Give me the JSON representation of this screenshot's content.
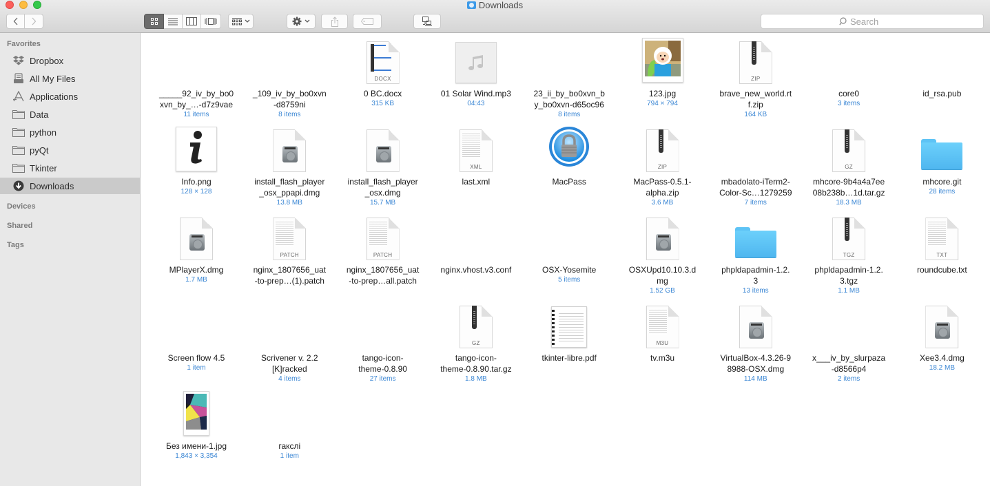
{
  "window": {
    "title": "Downloads",
    "search_placeholder": "Search"
  },
  "toolbar": {
    "back_icon": "chevron-left-icon",
    "forward_icon": "chevron-right-icon",
    "view_modes": [
      "icon-view",
      "list-view",
      "column-view",
      "cover-flow-view"
    ],
    "active_view": "icon-view",
    "arrange_icon": "arrange-grid-icon",
    "action_icon": "gear-icon",
    "share_icon": "share-icon",
    "tag_icon": "tag-icon",
    "network_icon": "connect-server-icon"
  },
  "sidebar": {
    "favorites_header": "Favorites",
    "devices_header": "Devices",
    "shared_header": "Shared",
    "tags_header": "Tags",
    "items": [
      {
        "label": "Dropbox",
        "icon": "dropbox-icon"
      },
      {
        "label": "All My Files",
        "icon": "all-files-icon"
      },
      {
        "label": "Applications",
        "icon": "applications-icon"
      },
      {
        "label": "Data",
        "icon": "folder-icon"
      },
      {
        "label": "python",
        "icon": "folder-icon"
      },
      {
        "label": "pyQt",
        "icon": "folder-icon"
      },
      {
        "label": "Tkinter",
        "icon": "folder-icon"
      },
      {
        "label": "Downloads",
        "icon": "downloads-icon",
        "selected": true
      }
    ]
  },
  "files": [
    {
      "name": "_____92_iv_by_bo0xvn_by_…-d7z9vae",
      "meta": "11 items",
      "type": "none"
    },
    {
      "name": "_109_iv_by_bo0xvn-d8759ni",
      "meta": "8 items",
      "type": "none"
    },
    {
      "name": "0 BC.docx",
      "meta": "315 KB",
      "type": "docx",
      "label": "DOCX"
    },
    {
      "name": "01 Solar Wind.mp3",
      "meta": "04:43",
      "type": "audio"
    },
    {
      "name": "23_ii_by_bo0xvn_by_bo0xvn-d65oc96",
      "meta": "8 items",
      "type": "none"
    },
    {
      "name": "123.jpg",
      "meta": "794 × 794",
      "type": "image-finn"
    },
    {
      "name": "brave_new_world.rtf.zip",
      "meta": "164 KB",
      "type": "zip",
      "label": "ZIP"
    },
    {
      "name": "core0",
      "meta": "3 items",
      "type": "none"
    },
    {
      "name": "id_rsa.pub",
      "meta": "",
      "type": "none"
    },
    {
      "name": "Info.png",
      "meta": "128 × 128",
      "type": "image-info"
    },
    {
      "name": "install_flash_player_osx_ppapi.dmg",
      "meta": "13.8 MB",
      "type": "dmg"
    },
    {
      "name": "install_flash_player_osx.dmg",
      "meta": "15.7 MB",
      "type": "dmg"
    },
    {
      "name": "last.xml",
      "meta": "",
      "type": "text",
      "label": "XML"
    },
    {
      "name": "MacPass",
      "meta": "",
      "type": "app-macpass"
    },
    {
      "name": "MacPass-0.5.1-alpha.zip",
      "meta": "3.6 MB",
      "type": "zip",
      "label": "ZIP"
    },
    {
      "name": "mbadolato-iTerm2-Color-Sc…1279259",
      "meta": "7 items",
      "type": "none"
    },
    {
      "name": "mhcore-9b4a4a7ee08b238b…1d.tar.gz",
      "meta": "18.3 MB",
      "type": "zip",
      "label": "GZ"
    },
    {
      "name": "mhcore.git",
      "meta": "28 items",
      "type": "folder"
    },
    {
      "name": "MPlayerX.dmg",
      "meta": "1.7 MB",
      "type": "dmg"
    },
    {
      "name": "nginx_1807656_uat-to-prep…(1).patch",
      "meta": "",
      "type": "text",
      "label": "PATCH"
    },
    {
      "name": "nginx_1807656_uat-to-prep…all.patch",
      "meta": "",
      "type": "text",
      "label": "PATCH"
    },
    {
      "name": "nginx.vhost.v3.conf",
      "meta": "",
      "type": "none"
    },
    {
      "name": "OSX-Yosemite",
      "meta": "5 items",
      "type": "none"
    },
    {
      "name": "OSXUpd10.10.3.dmg",
      "meta": "1.52 GB",
      "type": "dmg"
    },
    {
      "name": "phpldapadmin-1.2.3",
      "meta": "13 items",
      "type": "folder"
    },
    {
      "name": "phpldapadmin-1.2.3.tgz",
      "meta": "1.1 MB",
      "type": "zip",
      "label": "TGZ"
    },
    {
      "name": "roundcube.txt",
      "meta": "",
      "type": "text",
      "label": "TXT"
    },
    {
      "name": "Screen flow 4.5",
      "meta": "1 item",
      "type": "none"
    },
    {
      "name": "Scrivener v. 2.2 [K]racked",
      "meta": "4 items",
      "type": "none"
    },
    {
      "name": "tango-icon-theme-0.8.90",
      "meta": "27 items",
      "type": "none"
    },
    {
      "name": "tango-icon-theme-0.8.90.tar.gz",
      "meta": "1.8 MB",
      "type": "zip",
      "label": "GZ"
    },
    {
      "name": "tkinter-libre.pdf",
      "meta": "",
      "type": "pdf"
    },
    {
      "name": "tv.m3u",
      "meta": "",
      "type": "text",
      "label": "M3U"
    },
    {
      "name": "VirtualBox-4.3.26-98988-OSX.dmg",
      "meta": "114 MB",
      "type": "dmg"
    },
    {
      "name": "x___iv_by_slurpaza-d8566p4",
      "meta": "2 items",
      "type": "none"
    },
    {
      "name": "Xee3.4.dmg",
      "meta": "18.2 MB",
      "type": "dmg"
    },
    {
      "name": "Без имени-1.jpg",
      "meta": "1,843 × 3,354",
      "type": "image-abstract"
    },
    {
      "name": "гакслі",
      "meta": "1 item",
      "type": "none"
    }
  ],
  "name_lines": {
    "0": [
      "_____92_iv_by_bo0",
      "xvn_by_…-d7z9vae"
    ],
    "1": [
      "_109_iv_by_bo0xvn",
      "-d8759ni"
    ],
    "4": [
      "23_ii_by_bo0xvn_b",
      "y_bo0xvn-d65oc96"
    ],
    "6": [
      "brave_new_world.rt",
      "f.zip"
    ],
    "10": [
      "install_flash_player",
      "_osx_ppapi.dmg"
    ],
    "11": [
      "install_flash_player",
      "_osx.dmg"
    ],
    "14": [
      "MacPass-0.5.1-",
      "alpha.zip"
    ],
    "15": [
      "mbadolato-iTerm2-",
      "Color-Sc…1279259"
    ],
    "16": [
      "mhcore-9b4a4a7ee",
      "08b238b…1d.tar.gz"
    ],
    "19": [
      "nginx_1807656_uat",
      "-to-prep…(1).patch"
    ],
    "20": [
      "nginx_1807656_uat",
      "-to-prep…all.patch"
    ],
    "23": [
      "OSXUpd10.10.3.d",
      "mg"
    ],
    "24": [
      "phpldapadmin-1.2.",
      "3"
    ],
    "25": [
      "phpldapadmin-1.2.",
      "3.tgz"
    ],
    "28": [
      "Scrivener v. 2.2",
      "[K]racked"
    ],
    "29": [
      "tango-icon-",
      "theme-0.8.90"
    ],
    "30": [
      "tango-icon-",
      "theme-0.8.90.tar.gz"
    ],
    "33": [
      "VirtualBox-4.3.26-9",
      "8988-OSX.dmg"
    ],
    "34": [
      "x___iv_by_slurpaza",
      "-d8566p4"
    ]
  },
  "colors": {
    "meta_text": "#3a86d4",
    "folder_blue": "#5ec3f5",
    "selected_sidebar": "#cacaca"
  }
}
